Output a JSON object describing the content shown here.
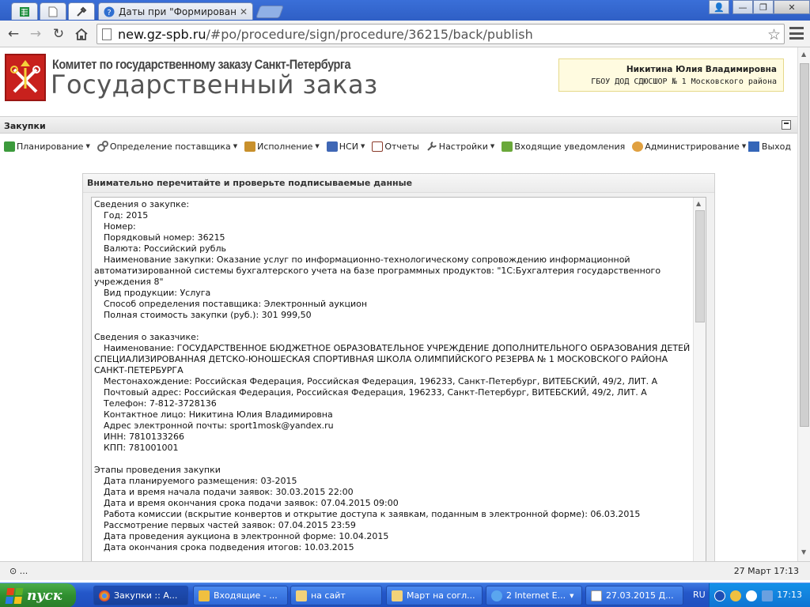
{
  "browser": {
    "tab_title": "Даты при \"Формирование и",
    "url_host": "new.gz-spb.ru",
    "url_path": "/#po/procedure/sign/procedure/36215/back/publish"
  },
  "header": {
    "org_name": "Комитет по государственному заказу Санкт-Петербурга",
    "site_name": "Государственный заказ",
    "user_name": "Никитина Юлия Владимировна",
    "user_org": "ГБОУ ДОД СДЮСШОР № 1 Московского района"
  },
  "section": {
    "title": "Закупки"
  },
  "menu": {
    "items": [
      {
        "label": "Планирование",
        "dropdown": true,
        "icon": "planning-icon"
      },
      {
        "label": "Определение поставщика",
        "dropdown": true,
        "icon": "gears-icon"
      },
      {
        "label": "Исполнение",
        "dropdown": true,
        "icon": "execution-icon"
      },
      {
        "label": "НСИ",
        "dropdown": true,
        "icon": "book-icon"
      },
      {
        "label": "Отчеты",
        "dropdown": false,
        "icon": "report-icon"
      },
      {
        "label": "Настройки",
        "dropdown": true,
        "icon": "wrench-icon"
      },
      {
        "label": "Входящие уведомления",
        "dropdown": false,
        "icon": "inbox-icon"
      },
      {
        "label": "Администрирование",
        "dropdown": true,
        "icon": "user-admin-icon"
      }
    ],
    "logout": "Выход"
  },
  "panel": {
    "title": "Внимательно перечитайте и проверьте подписываемые данные",
    "lines": [
      {
        "t": "Сведения о закупке:",
        "i": 0
      },
      {
        "t": "Год: 2015",
        "i": 1
      },
      {
        "t": "Номер:",
        "i": 1
      },
      {
        "t": "Порядковый номер: 36215",
        "i": 1
      },
      {
        "t": "Валюта: Российский рубль",
        "i": 1
      },
      {
        "t": "Наименование закупки: Оказание услуг по информационно-технологическому сопровождению информационной",
        "i": 1
      },
      {
        "t": "автоматизированной системы бухгалтерского учета на базе программных продуктов: \"1С:Бухгалтерия государственного",
        "i": 0
      },
      {
        "t": "учреждения 8\"",
        "i": 0
      },
      {
        "t": "Вид продукции: Услуга",
        "i": 1
      },
      {
        "t": "Способ определения поставщика: Электронный аукцион",
        "i": 1
      },
      {
        "t": "Полная стоимость закупки (руб.): 301 999,50",
        "i": 1
      },
      {
        "t": "",
        "i": 0
      },
      {
        "t": "Сведения о заказчике:",
        "i": 0
      },
      {
        "t": "Наименование: ГОСУДАРСТВЕННОЕ БЮДЖЕТНОЕ ОБРАЗОВАТЕЛЬНОЕ УЧРЕЖДЕНИЕ ДОПОЛНИТЕЛЬНОГО ОБРАЗОВАНИЯ ДЕТЕЙ",
        "i": 1
      },
      {
        "t": "СПЕЦИАЛИЗИРОВАННАЯ ДЕТСКО-ЮНОШЕСКАЯ СПОРТИВНАЯ ШКОЛА ОЛИМПИЙСКОГО РЕЗЕРВА № 1 МОСКОВСКОГО РАЙОНА",
        "i": 0
      },
      {
        "t": "САНКТ-ПЕТЕРБУРГА",
        "i": 0
      },
      {
        "t": "Местонахождение: Российская Федерация, Российская Федерация, 196233, Санкт-Петербург, ВИТЕБСКИЙ, 49/2, ЛИТ. А",
        "i": 1
      },
      {
        "t": "Почтовый адрес: Российская Федерация, Российская Федерация, 196233, Санкт-Петербург, ВИТЕБСКИЙ, 49/2, ЛИТ. А",
        "i": 1
      },
      {
        "t": "Телефон: 7-812-3728136",
        "i": 1
      },
      {
        "t": "Контактное лицо: Никитина Юлия Владимировна",
        "i": 1
      },
      {
        "t": "Адрес электронной почты: sport1mosk@yandex.ru",
        "i": 1
      },
      {
        "t": "ИНН: 7810133266",
        "i": 1
      },
      {
        "t": "КПП: 781001001",
        "i": 1
      },
      {
        "t": "",
        "i": 0
      },
      {
        "t": "Этапы проведения закупки",
        "i": 0
      },
      {
        "t": "Дата планируемого размещения: 03-2015",
        "i": 1
      },
      {
        "t": "Дата и время начала подачи заявок: 30.03.2015 22:00",
        "i": 1
      },
      {
        "t": "Дата и время окончания срока подачи заявок: 07.04.2015 09:00",
        "i": 1
      },
      {
        "t": "Работа комиссии (вскрытие конвертов и открытие доступа к заявкам, поданным в электронной форме): 06.03.2015",
        "i": 1
      },
      {
        "t": "Рассмотрение первых частей заявок: 07.04.2015 23:59",
        "i": 1
      },
      {
        "t": "Дата проведения аукциона в электронной форме: 10.04.2015",
        "i": 1
      },
      {
        "t": "Дата окончания срока подведения итогов: 10.03.2015",
        "i": 1
      }
    ]
  },
  "status": {
    "left": "...",
    "right": "27 Март 17:13"
  },
  "taskbar": {
    "start": "пуск",
    "items": [
      {
        "label": "Закупки :: А...",
        "icon": "chrome-icon",
        "color": "#e8a825"
      },
      {
        "label": "Входящие - ...",
        "icon": "mail-icon",
        "color": "#f0c040"
      },
      {
        "label": "на сайт",
        "icon": "folder-icon",
        "color": "#f2d27a"
      },
      {
        "label": "Март на согл...",
        "icon": "folder-icon",
        "color": "#f2d27a"
      },
      {
        "label": "2 Internet E...",
        "icon": "ie-icon",
        "color": "#5aa6ef"
      },
      {
        "label": "27.03.2015 Д...",
        "icon": "document-icon",
        "color": "#ffffff"
      }
    ],
    "lang": "RU",
    "clock": "17:13"
  }
}
